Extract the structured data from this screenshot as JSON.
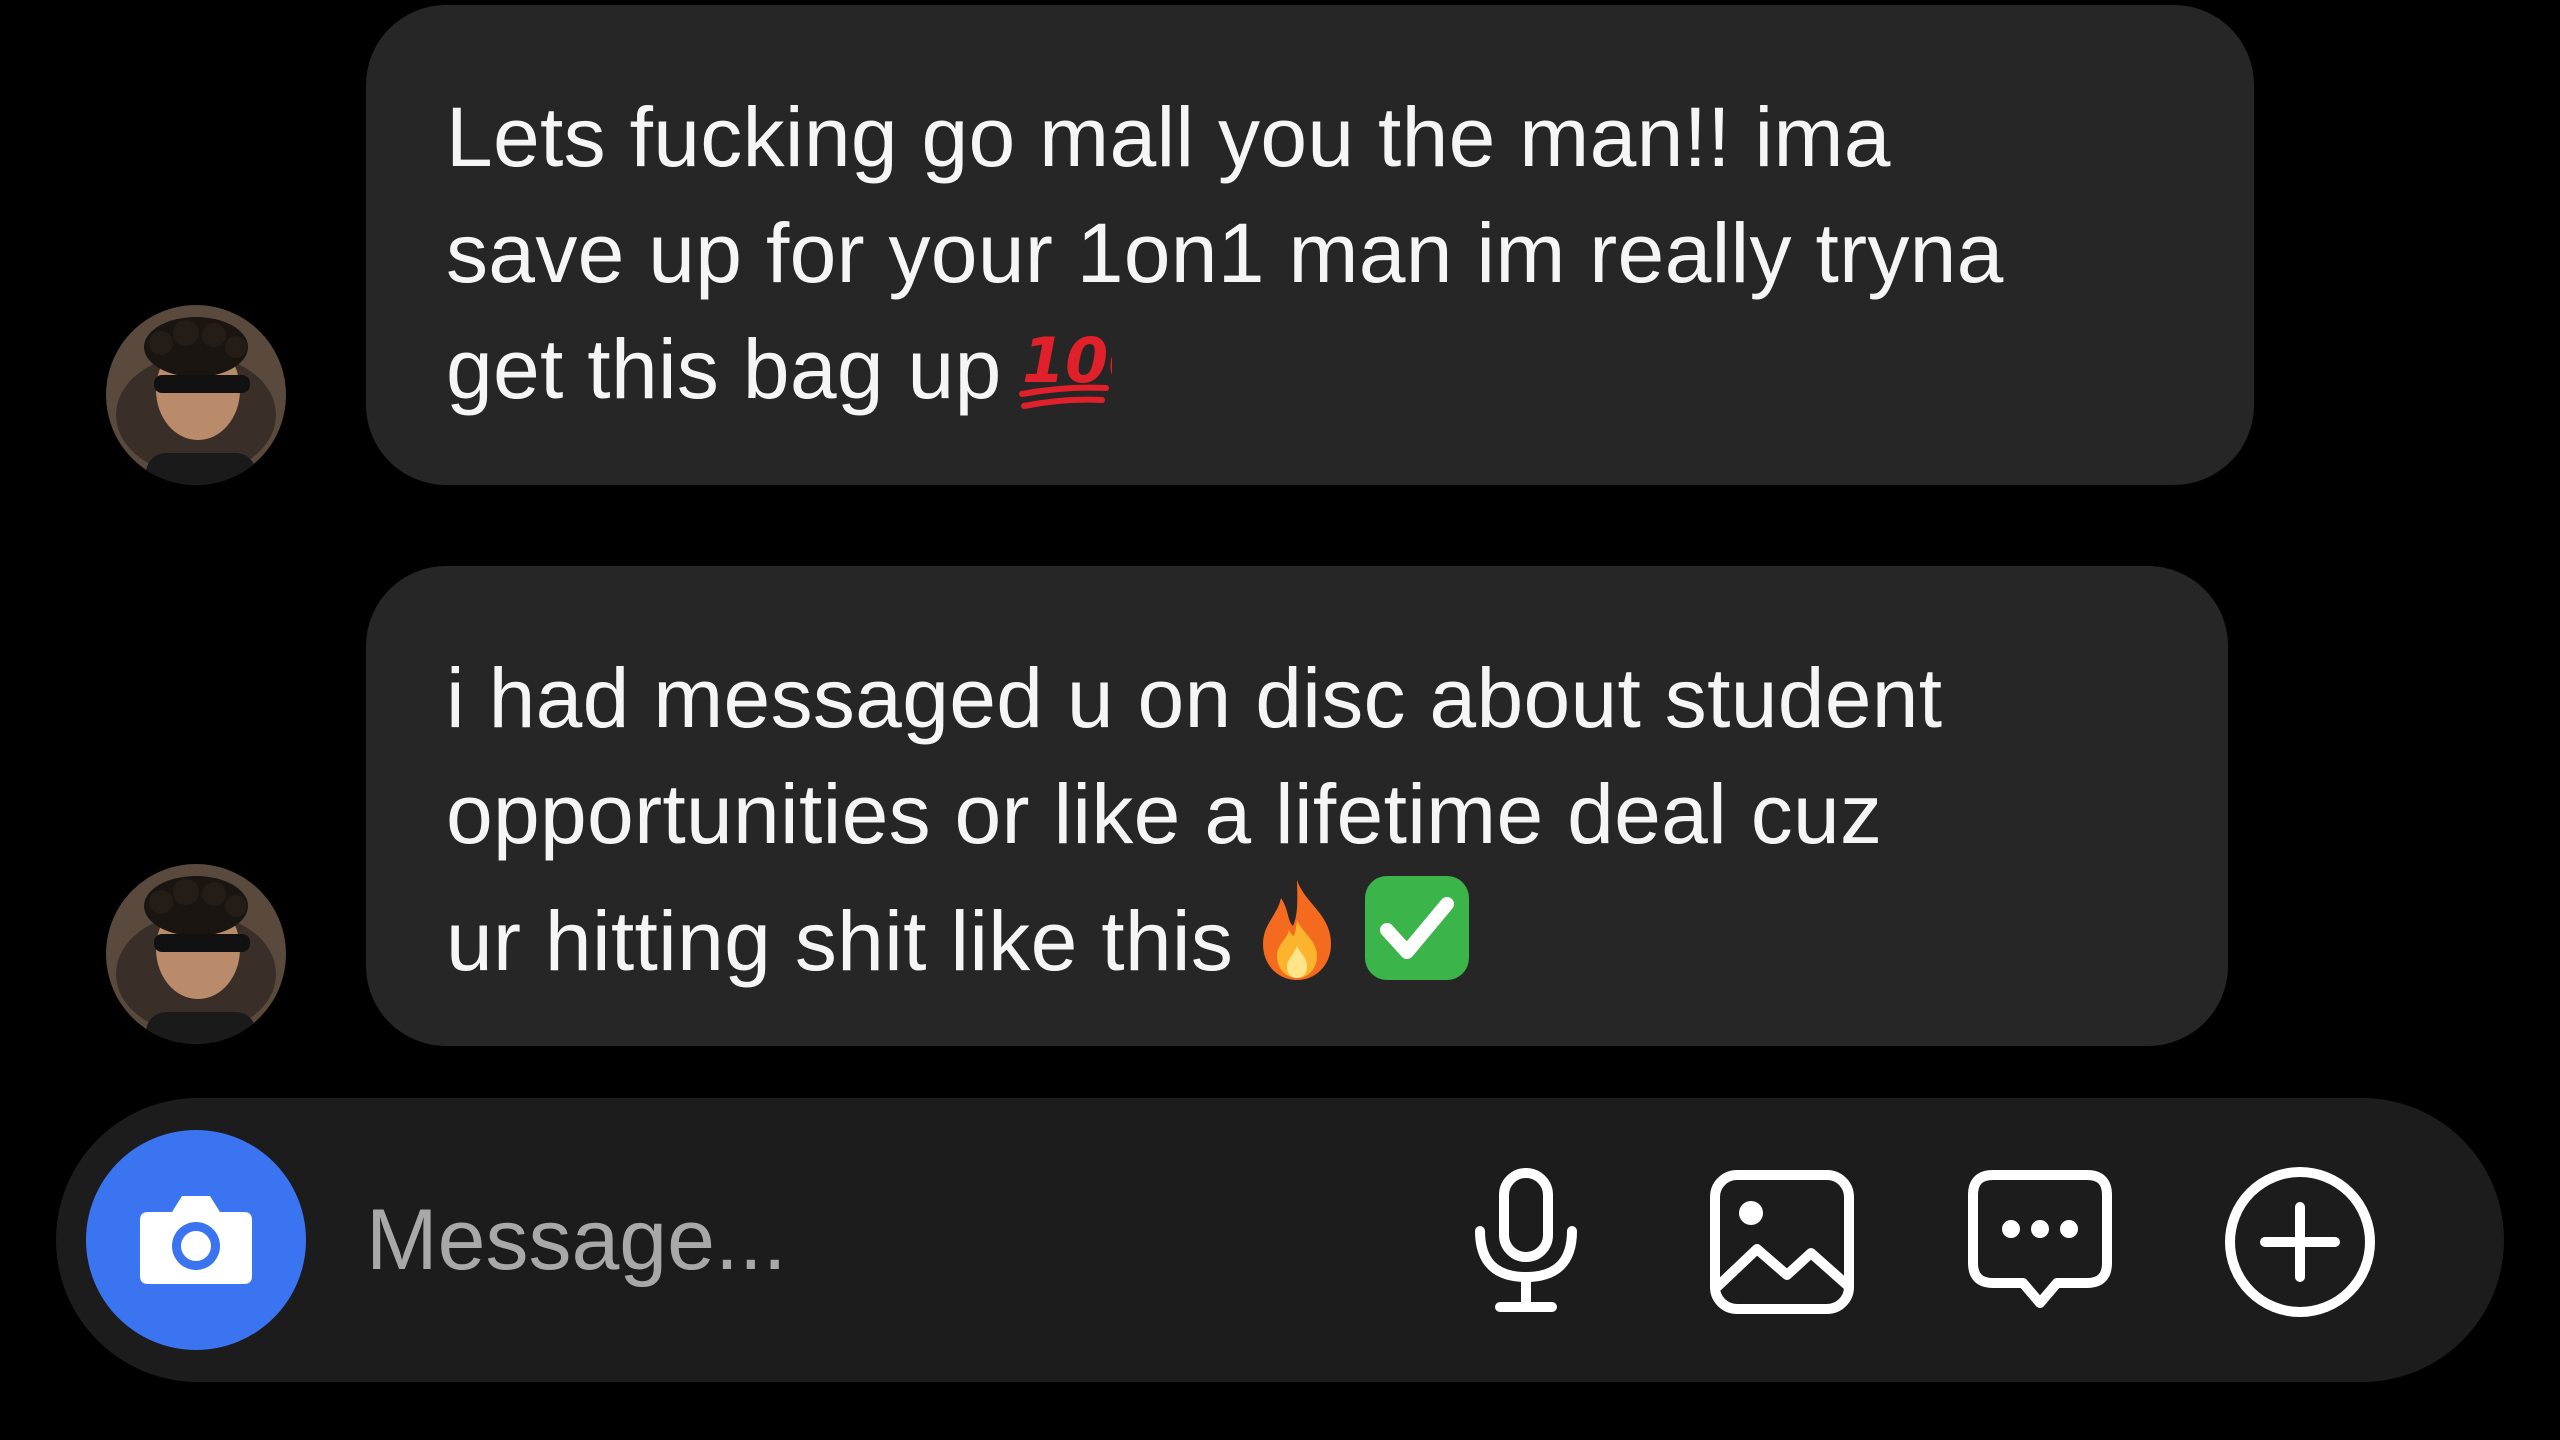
{
  "conversation": {
    "messages": [
      {
        "text": "Lets fucking go mall you the man!! ima\nsave up for your 1on1 man im really tryna\nget this bag up",
        "emojis": [
          "hundred-points"
        ]
      },
      {
        "text": "i had messaged u on disc about student\nopportunities or like a lifetime deal cuz\nur hitting shit like this",
        "emojis": [
          "fire",
          "check-mark-button"
        ]
      }
    ]
  },
  "composer": {
    "placeholder": "Message...",
    "icons": [
      "camera-icon",
      "microphone-icon",
      "gallery-icon",
      "sticker-icon",
      "add-icon"
    ],
    "camera_color": "#3b74f0"
  },
  "theme": {
    "background": "#000000",
    "bubble": "#262626",
    "text": "#f5f5f5"
  }
}
